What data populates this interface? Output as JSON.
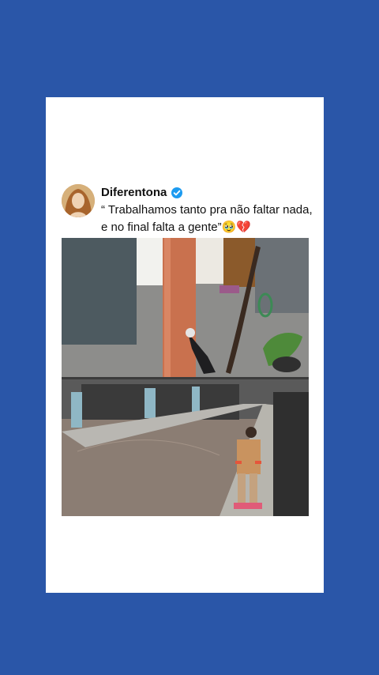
{
  "post": {
    "username": "Diferentona",
    "quote_text": "“ Trabalhamos tanto pra não faltar nada, e no final falta a gente”🥹💔",
    "verified_icon": "verified-badge-icon",
    "colors": {
      "background": "#2a56a8",
      "card": "#ffffff",
      "verified": "#1d9bf0"
    }
  }
}
